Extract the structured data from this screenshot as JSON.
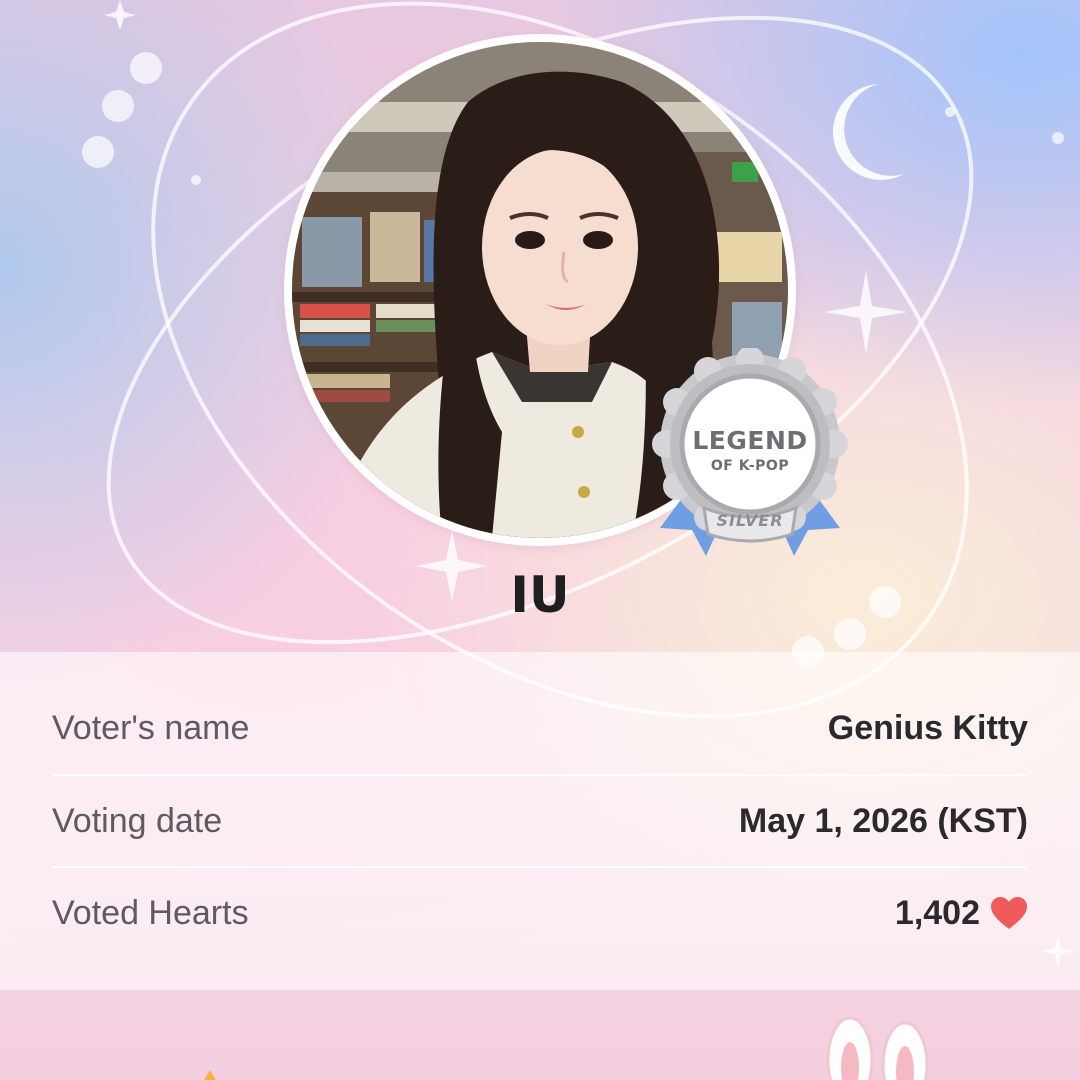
{
  "idol": {
    "name": "IU"
  },
  "badge": {
    "title": "LEGEND",
    "subtitle": "OF K-POP",
    "tier": "SILVER"
  },
  "details": {
    "voter_name_label": "Voter's name",
    "voter_name_value": "Genius Kitty",
    "voting_date_label": "Voting date",
    "voting_date_value": "May 1, 2026 (KST)",
    "voted_hearts_label": "Voted Hearts",
    "voted_hearts_value": "1,402",
    "heart_icon": "heart-icon",
    "heart_color": "#ef5b5b"
  },
  "decor": {
    "moon_icon": "crescent-moon-icon",
    "star_icon": "sparkle-icon",
    "orbit": "orbit-ring"
  }
}
